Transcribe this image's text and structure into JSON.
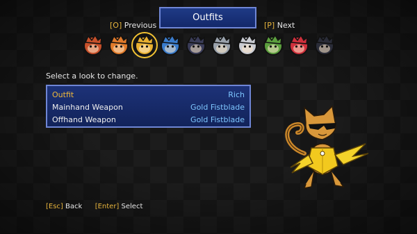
{
  "header": {
    "title": "Outfits"
  },
  "nav": {
    "previous_key": "[O]",
    "previous_label": "Previous",
    "next_key": "[P]",
    "next_label": "Next"
  },
  "portraits": {
    "selected_index": 2,
    "items": [
      {
        "icon": "red-spiky-hair-icon",
        "color": "#c8502a"
      },
      {
        "icon": "orange-hair-icon",
        "color": "#e07a2a"
      },
      {
        "icon": "yellow-cat-icon",
        "color": "#e8b030"
      },
      {
        "icon": "blue-bird-icon",
        "color": "#3a7ccc"
      },
      {
        "icon": "dark-masked-icon",
        "color": "#3a3c58"
      },
      {
        "icon": "grey-helmet-icon",
        "color": "#9aa2ac"
      },
      {
        "icon": "pale-ghost-icon",
        "color": "#c9cbd2"
      },
      {
        "icon": "green-elf-icon",
        "color": "#5ca03e"
      },
      {
        "icon": "red-dragon-icon",
        "color": "#d0303c"
      },
      {
        "icon": "shadow-icon",
        "color": "#2a2c38"
      }
    ]
  },
  "prompt": "Select a look to change.",
  "menu": {
    "rows": [
      {
        "label": "Outfit",
        "value": "Rich"
      },
      {
        "label": "Mainhand Weapon",
        "value": "Gold Fistblade"
      },
      {
        "label": "Offhand Weapon",
        "value": "Gold Fistblade"
      }
    ]
  },
  "footer": {
    "back_key": "[Esc]",
    "back_label": "Back",
    "select_key": "[Enter]",
    "select_label": "Select"
  },
  "colors": {
    "accent": "#e7b43c",
    "panel": "#1d3278",
    "border": "#6f86d6",
    "value": "#7ec6ff"
  }
}
